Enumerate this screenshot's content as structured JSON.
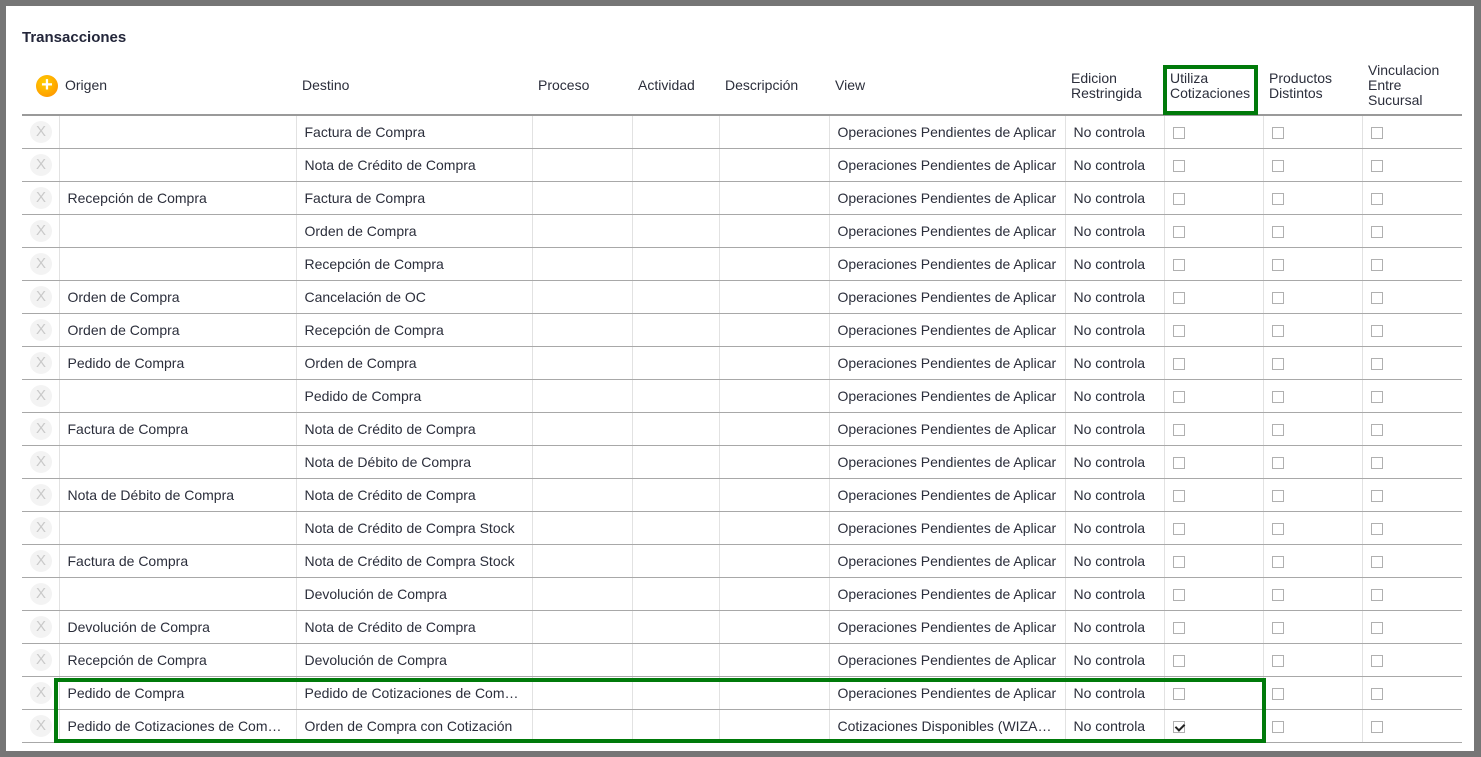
{
  "title": "Transacciones",
  "columns": {
    "origen": "Origen",
    "destino": "Destino",
    "proceso": "Proceso",
    "actividad": "Actividad",
    "descripcion": "Descripción",
    "view": "View",
    "edicion": "Edicion Restringida",
    "utiliza": "Utiliza Cotizaciones",
    "productos": "Productos Distintos",
    "vinculacion": "Vinculacion Entre Sucursal"
  },
  "delete_label": "X",
  "add_label": "+",
  "rows": [
    {
      "origen": "",
      "destino": "Factura de Compra",
      "view": "Operaciones Pendientes de Aplicar",
      "edicion": "No controla",
      "utiliza": false,
      "productos": false,
      "vinculacion": false
    },
    {
      "origen": "",
      "destino": "Nota de Crédito de Compra",
      "view": "Operaciones Pendientes de Aplicar",
      "edicion": "No controla",
      "utiliza": false,
      "productos": false,
      "vinculacion": false
    },
    {
      "origen": "Recepción de Compra",
      "destino": "Factura de Compra",
      "view": "Operaciones Pendientes de Aplicar",
      "edicion": "No controla",
      "utiliza": false,
      "productos": false,
      "vinculacion": false
    },
    {
      "origen": "",
      "destino": "Orden de Compra",
      "view": "Operaciones Pendientes de Aplicar",
      "edicion": "No controla",
      "utiliza": false,
      "productos": false,
      "vinculacion": false
    },
    {
      "origen": "",
      "destino": "Recepción de Compra",
      "view": "Operaciones Pendientes de Aplicar",
      "edicion": "No controla",
      "utiliza": false,
      "productos": false,
      "vinculacion": false
    },
    {
      "origen": "Orden de Compra",
      "destino": "Cancelación de OC",
      "view": "Operaciones Pendientes de Aplicar",
      "edicion": "No controla",
      "utiliza": false,
      "productos": false,
      "vinculacion": false
    },
    {
      "origen": "Orden de Compra",
      "destino": "Recepción de Compra",
      "view": "Operaciones Pendientes de Aplicar",
      "edicion": "No controla",
      "utiliza": false,
      "productos": false,
      "vinculacion": false
    },
    {
      "origen": "Pedido de Compra",
      "destino": "Orden de Compra",
      "view": "Operaciones Pendientes de Aplicar",
      "edicion": "No controla",
      "utiliza": false,
      "productos": false,
      "vinculacion": false
    },
    {
      "origen": "",
      "destino": "Pedido de Compra",
      "view": "Operaciones Pendientes de Aplicar",
      "edicion": "No controla",
      "utiliza": false,
      "productos": false,
      "vinculacion": false
    },
    {
      "origen": "Factura de Compra",
      "destino": "Nota de Crédito de Compra",
      "view": "Operaciones Pendientes de Aplicar",
      "edicion": "No controla",
      "utiliza": false,
      "productos": false,
      "vinculacion": false
    },
    {
      "origen": "",
      "destino": "Nota de Débito de Compra",
      "view": "Operaciones Pendientes de Aplicar",
      "edicion": "No controla",
      "utiliza": false,
      "productos": false,
      "vinculacion": false
    },
    {
      "origen": "Nota de Débito de Compra",
      "destino": "Nota de Crédito de Compra",
      "view": "Operaciones Pendientes de Aplicar",
      "edicion": "No controla",
      "utiliza": false,
      "productos": false,
      "vinculacion": false
    },
    {
      "origen": "",
      "destino": "Nota de Crédito de Compra Stock",
      "view": "Operaciones Pendientes de Aplicar",
      "edicion": "No controla",
      "utiliza": false,
      "productos": false,
      "vinculacion": false
    },
    {
      "origen": "Factura de Compra",
      "destino": "Nota de Crédito de Compra Stock",
      "view": "Operaciones Pendientes de Aplicar",
      "edicion": "No controla",
      "utiliza": false,
      "productos": false,
      "vinculacion": false
    },
    {
      "origen": "",
      "destino": "Devolución de Compra",
      "view": "Operaciones Pendientes de Aplicar",
      "edicion": "No controla",
      "utiliza": false,
      "productos": false,
      "vinculacion": false
    },
    {
      "origen": "Devolución de Compra",
      "destino": "Nota de Crédito de Compra",
      "view": "Operaciones Pendientes de Aplicar",
      "edicion": "No controla",
      "utiliza": false,
      "productos": false,
      "vinculacion": false
    },
    {
      "origen": "Recepción de Compra",
      "destino": "Devolución de Compra",
      "view": "Operaciones Pendientes de Aplicar",
      "edicion": "No controla",
      "utiliza": false,
      "productos": false,
      "vinculacion": false
    },
    {
      "origen": "Pedido de Compra",
      "destino": "Pedido de Cotizaciones de Compra",
      "view": "Operaciones Pendientes de Aplicar",
      "edicion": "No controla",
      "utiliza": false,
      "productos": false,
      "vinculacion": false
    },
    {
      "origen": "Pedido de Cotizaciones de Compra",
      "destino": "Orden de Compra con Cotización",
      "view": "Cotizaciones Disponibles (WIZARD)",
      "edicion": "No controla",
      "utiliza": true,
      "productos": false,
      "vinculacion": false
    }
  ],
  "highlight_color": "#007a0a"
}
